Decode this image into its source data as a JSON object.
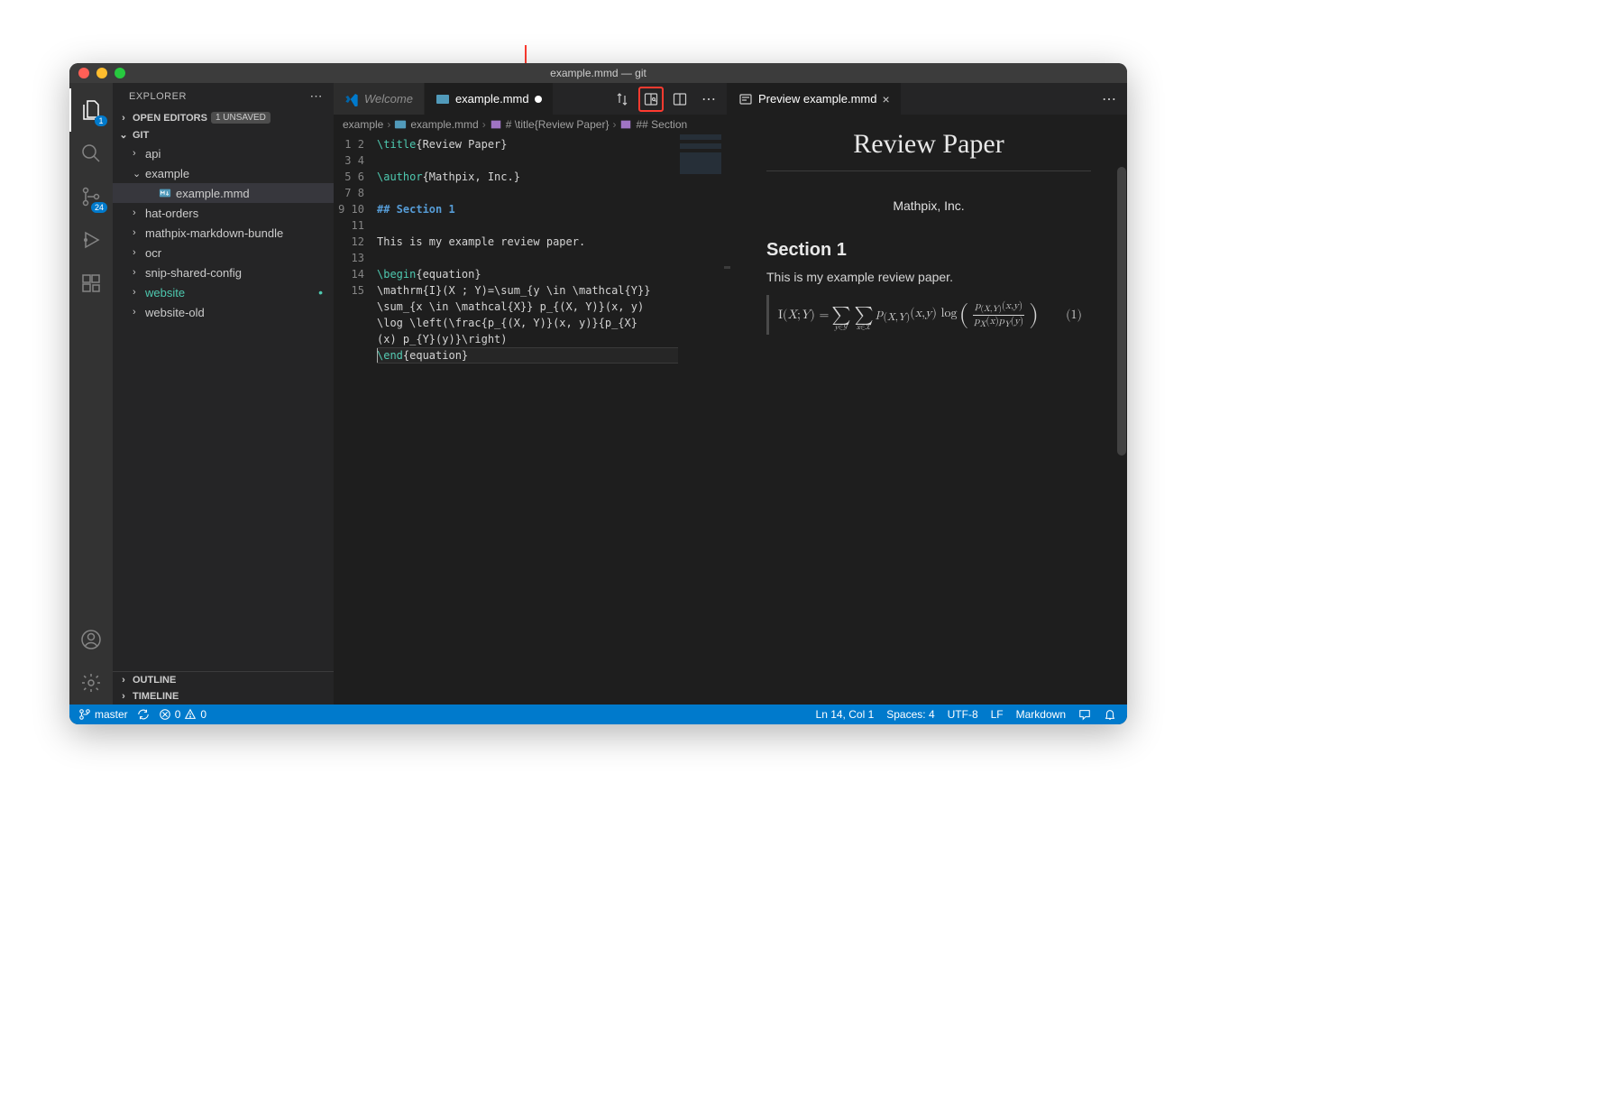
{
  "window": {
    "title": "example.mmd — git"
  },
  "activitybar": {
    "explorer_badge": "1",
    "scm_badge": "24"
  },
  "sidebar": {
    "title": "EXPLORER",
    "open_editors_label": "OPEN EDITORS",
    "unsaved_label": "1 UNSAVED",
    "root_label": "GIT",
    "outline_label": "OUTLINE",
    "timeline_label": "TIMELINE",
    "items": [
      {
        "label": "api",
        "type": "folder"
      },
      {
        "label": "example",
        "type": "folder"
      },
      {
        "label": "example.mmd",
        "type": "file"
      },
      {
        "label": "hat-orders",
        "type": "folder"
      },
      {
        "label": "mathpix-markdown-bundle",
        "type": "folder"
      },
      {
        "label": "ocr",
        "type": "folder"
      },
      {
        "label": "snip-shared-config",
        "type": "folder"
      },
      {
        "label": "website",
        "type": "folder"
      },
      {
        "label": "website-old",
        "type": "folder"
      }
    ]
  },
  "tabs": {
    "welcome_label": "Welcome",
    "editor_label": "example.mmd",
    "preview_label": "Preview example.mmd"
  },
  "breadcrumb": {
    "a": "example",
    "b": "example.mmd",
    "c": "# \\title{Review Paper}",
    "d": "## Section"
  },
  "code": {
    "lines": [
      "1",
      "2",
      "3",
      "4",
      "5",
      "6",
      "7",
      "8",
      "9",
      "10",
      "11",
      "12",
      "13",
      "14",
      "15"
    ],
    "l1a": "\\title",
    "l1b": "{Review Paper}",
    "l3a": "\\author",
    "l3b": "{Mathpix, Inc.}",
    "l5": "## Section 1",
    "l7": "This is my example review paper.",
    "l9a": "\\begin",
    "l9b": "{equation}",
    "l10": "\\mathrm{I}(X ; Y)=\\sum_{y \\in \\mathcal{Y}} \\sum_{x \\in \\mathcal{X}} p_{(X, Y)}(x, y) \\log \\left(\\frac{p_{(X, Y)}(x, y)}{p_{X}(x) p_{Y}(y)}\\right)",
    "l11a": "\\end",
    "l11b": "{equation}"
  },
  "preview": {
    "title": "Review Paper",
    "author": "Mathpix, Inc.",
    "section": "Section 1",
    "para": "This is my example review paper.",
    "eqnum": "(1)"
  },
  "statusbar": {
    "branch": "master",
    "errors": "0",
    "warnings": "0",
    "cursor": "Ln 14, Col 1",
    "spaces": "Spaces: 4",
    "encoding": "UTF-8",
    "eol": "LF",
    "language": "Markdown"
  }
}
